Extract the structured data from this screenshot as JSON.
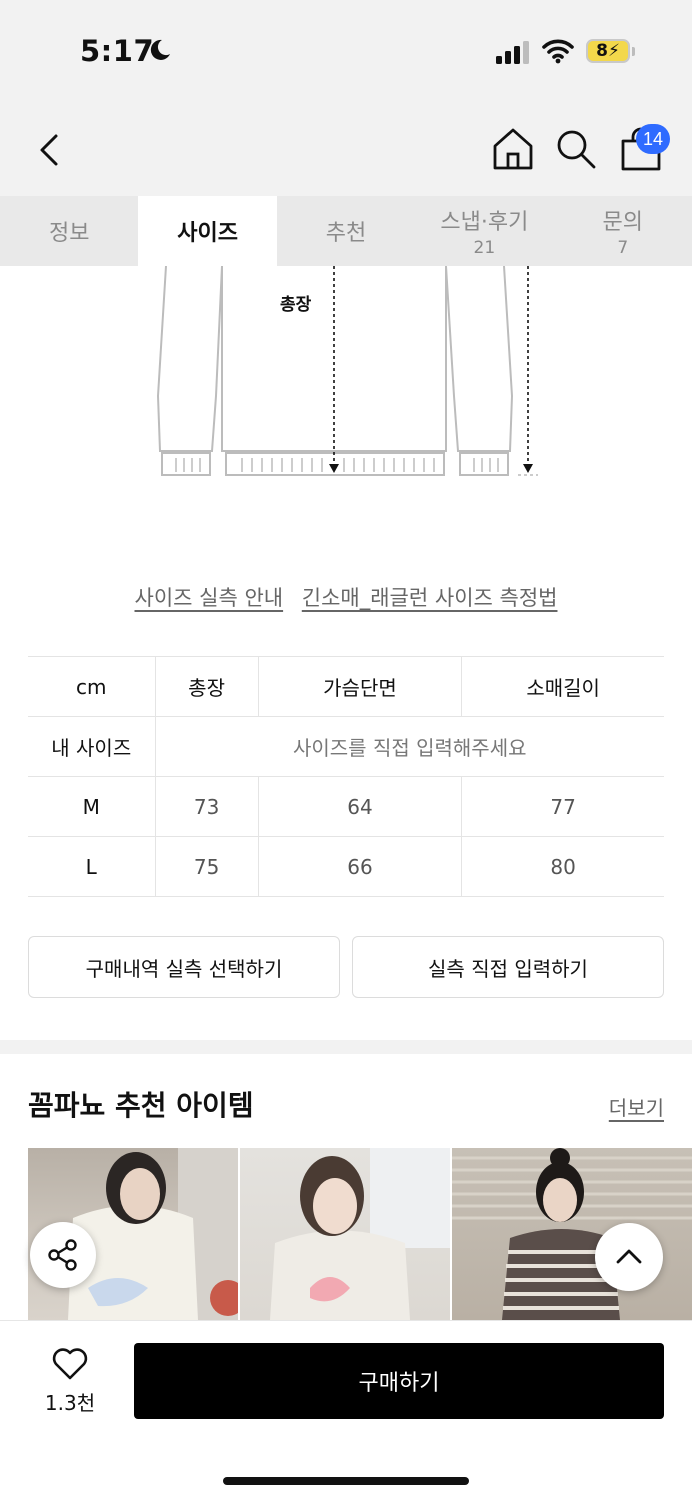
{
  "status_bar": {
    "time": "5:17",
    "battery": "8"
  },
  "header": {
    "cart_count": "14"
  },
  "tabs": [
    {
      "label": "정보",
      "count": ""
    },
    {
      "label": "사이즈",
      "count": ""
    },
    {
      "label": "추천",
      "count": ""
    },
    {
      "label": "스냅·후기",
      "count": "21"
    },
    {
      "label": "문의",
      "count": "7"
    }
  ],
  "active_tab": "사이즈",
  "illustration": {
    "label": "총장"
  },
  "guide_links": {
    "size_guide": "사이즈 실측 안내",
    "measure_method": "긴소매_래글런 사이즈 측정법"
  },
  "size_table": {
    "headers": [
      "cm",
      "총장",
      "가슴단면",
      "소매길이"
    ],
    "my_size_label": "내 사이즈",
    "my_size_placeholder": "사이즈를 직접 입력해주세요",
    "rows": [
      {
        "size": "M",
        "values": [
          "73",
          "64",
          "77"
        ]
      },
      {
        "size": "L",
        "values": [
          "75",
          "66",
          "80"
        ]
      }
    ]
  },
  "actions": {
    "history": "구매내역 실측 선택하기",
    "manual": "실측 직접 입력하기"
  },
  "recommend": {
    "title": "꼼파뇨 추천 아이템",
    "more": "더보기"
  },
  "bottom": {
    "like_count": "1.3천",
    "buy": "구매하기"
  },
  "colors": {
    "badge": "#2f6bff",
    "buy_button": "#000000",
    "battery": "#f3d84b"
  }
}
